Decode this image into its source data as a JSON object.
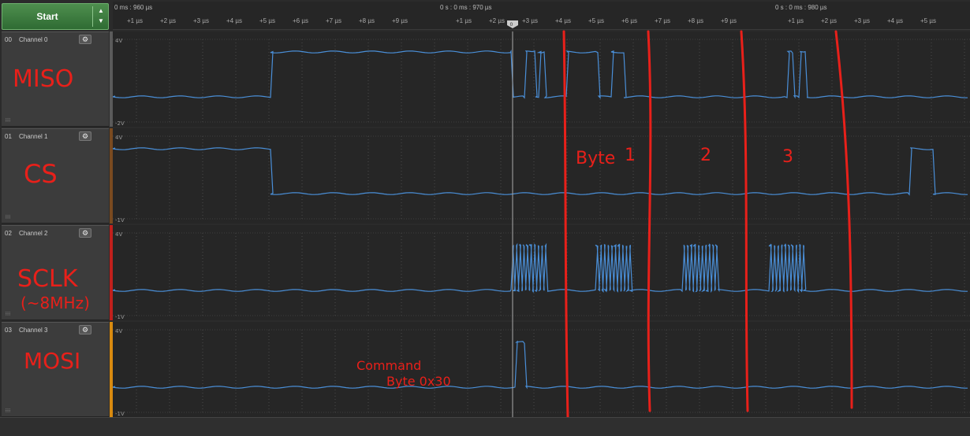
{
  "toolbar": {
    "start_label": "Start"
  },
  "timebar": {
    "refs": [
      "0 ms : 960 µs",
      "0 s : 0 ms : 970 µs",
      "0 s : 0 ms : 980 µs"
    ],
    "ticks": [
      "+1 µs",
      "+2 µs",
      "+3 µs",
      "+4 µs",
      "+5 µs",
      "+6 µs",
      "+7 µs",
      "+8 µs",
      "+9 µs",
      "+1 µs",
      "+2 µs",
      "+3 µs",
      "+4 µs",
      "+5 µs",
      "+6 µs",
      "+7 µs",
      "+8 µs",
      "+9 µs",
      "+1 µs",
      "+2 µs",
      "+3 µs",
      "+4 µs",
      "+5 µs"
    ]
  },
  "channels": [
    {
      "num": "00",
      "name": "Channel 0",
      "top_label": "4V",
      "bottom_label": "-2V",
      "color": "#5a5a5a",
      "note": "MISO"
    },
    {
      "num": "01",
      "name": "Channel 1",
      "top_label": "4V",
      "bottom_label": "-1V",
      "color": "#7a4a20",
      "note": "CS"
    },
    {
      "num": "02",
      "name": "Channel 2",
      "top_label": "4V",
      "bottom_label": "-1V",
      "color": "#c0201c",
      "note": "SCLK"
    },
    {
      "num": "03",
      "name": "Channel 3",
      "top_label": "4V",
      "bottom_label": "-1V",
      "color": "#d88a10",
      "note": "MOSI"
    }
  ],
  "annotations": {
    "sclk_sub": "(~8MHz)",
    "byte_label": "Byte",
    "byte_numbers": [
      "1",
      "2",
      "3"
    ],
    "command_line1": "Command",
    "command_line2": "Byte 0x30"
  },
  "colors": {
    "wave": "#4a8fd8",
    "annotation": "#e8201a",
    "grid": "#4a4a4a",
    "plot_bg": "#262626"
  }
}
